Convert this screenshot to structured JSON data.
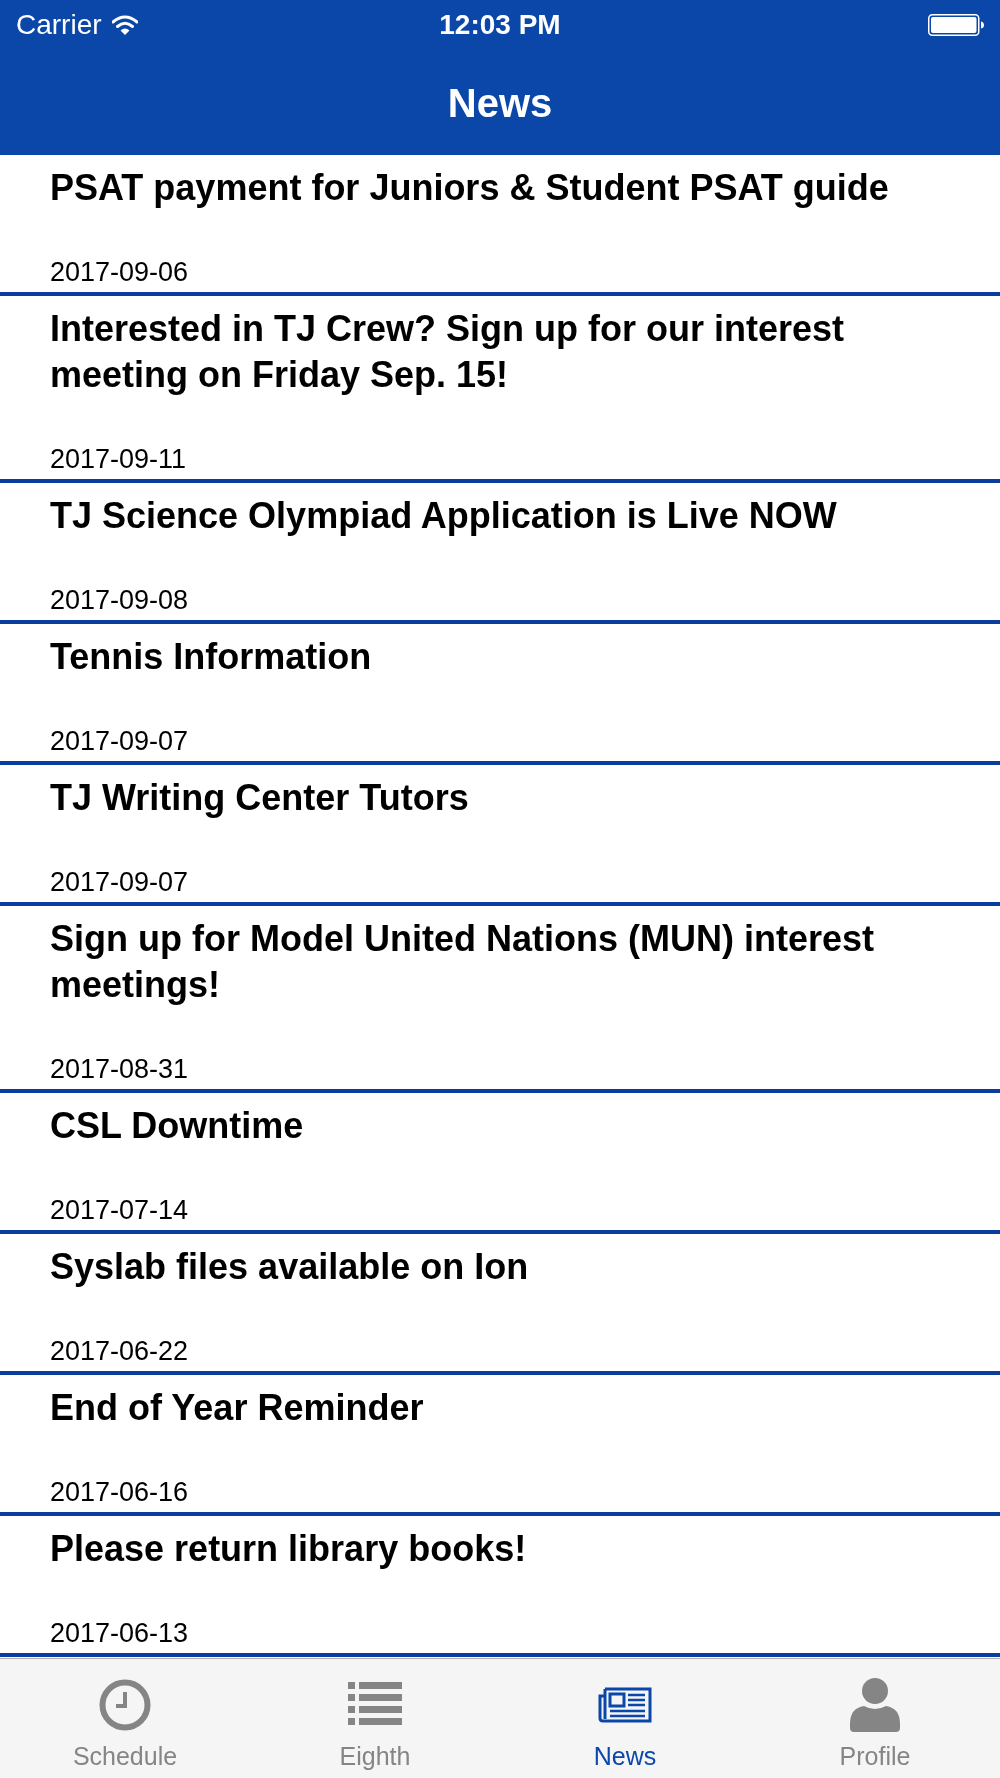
{
  "status_bar": {
    "carrier": "Carrier",
    "time": "12:03 PM"
  },
  "nav_bar": {
    "title": "News"
  },
  "news": [
    {
      "title": "PSAT payment for Juniors & Student PSAT guide",
      "date": "2017-09-06"
    },
    {
      "title": "Interested in TJ Crew? Sign up for our interest meeting on Friday Sep. 15!",
      "date": "2017-09-11"
    },
    {
      "title": "TJ Science Olympiad Application is Live NOW",
      "date": "2017-09-08"
    },
    {
      "title": "Tennis Information",
      "date": "2017-09-07"
    },
    {
      "title": "TJ Writing Center Tutors",
      "date": "2017-09-07"
    },
    {
      "title": "Sign up for Model United Nations (MUN) interest meetings!",
      "date": "2017-08-31"
    },
    {
      "title": "CSL Downtime",
      "date": "2017-07-14"
    },
    {
      "title": "Syslab files available on Ion",
      "date": "2017-06-22"
    },
    {
      "title": "End of Year Reminder",
      "date": "2017-06-16"
    },
    {
      "title": "Please return library books!",
      "date": "2017-06-13"
    }
  ],
  "tab_bar": [
    {
      "label": "Schedule",
      "selected": false
    },
    {
      "label": "Eighth",
      "selected": false
    },
    {
      "label": "News",
      "selected": true
    },
    {
      "label": "Profile",
      "selected": false
    }
  ]
}
